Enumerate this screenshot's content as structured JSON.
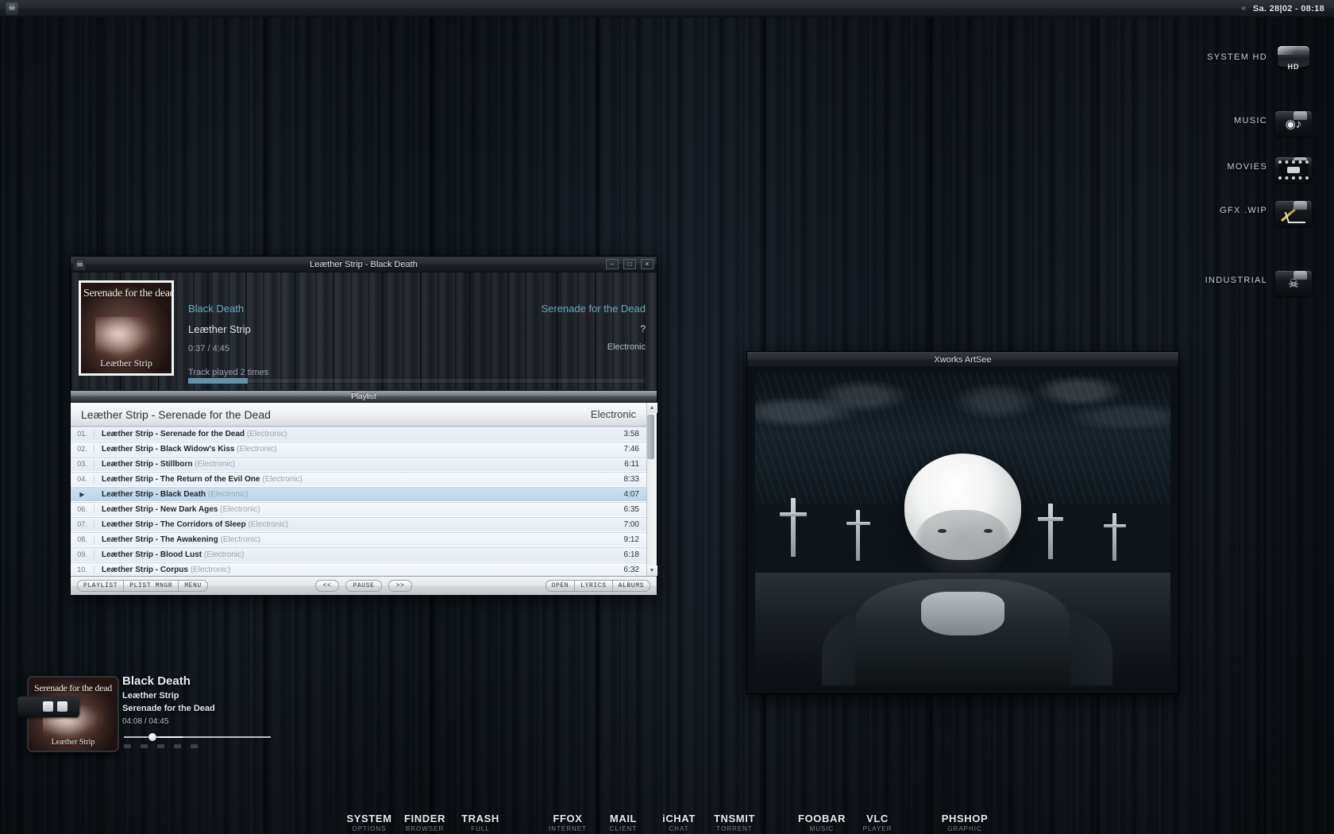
{
  "menubar": {
    "app_icon": "skull-icon",
    "collapse_arrows": "«",
    "clock": "Sa. 28|02 - 08:18"
  },
  "desktop_icons": [
    {
      "label": "SYSTEM HD",
      "icon": "harddisk-icon",
      "badge": "HD"
    },
    {
      "label": "MUSIC",
      "icon": "music-folder-icon",
      "glyph": "♫"
    },
    {
      "label": "MOVIES",
      "icon": "movies-folder-icon",
      "glyph": ""
    },
    {
      "label": "GFX .WIP",
      "icon": "graphics-folder-icon",
      "glyph": ""
    },
    {
      "label": "INDUSTRIAL",
      "icon": "skull-folder-icon",
      "glyph": "☠"
    }
  ],
  "player": {
    "window_title": "Leæther Strip - Black Death",
    "icon": "skull-icon",
    "window_buttons": {
      "minimize": "–",
      "maximize": "□",
      "close": "×"
    },
    "now_playing": {
      "track": "Black Death",
      "artist": "Leæther Strip",
      "time": "0:37 / 4:45",
      "play_count": "Track played 2 times",
      "album": "Serenade for the Dead",
      "rating": "?",
      "genre": "Electronic",
      "progress_percent": 13
    },
    "cover": {
      "title_top": "Serenade for the dead",
      "title_bottom": "Leæther Strip"
    },
    "playlist_tab": "Playlist",
    "playlist_header": {
      "title": "Leæther Strip - Serenade for the Dead",
      "genre": "Electronic"
    },
    "tracks": [
      {
        "num": "01.",
        "title": "Leæther Strip - Serenade for the Dead",
        "genre": "(Electronic)",
        "duration": "3:58",
        "playing": false
      },
      {
        "num": "02.",
        "title": "Leæther Strip - Black Widow's Kiss",
        "genre": "(Electronic)",
        "duration": "7:46",
        "playing": false
      },
      {
        "num": "03.",
        "title": "Leæther Strip - Stillborn",
        "genre": "(Electronic)",
        "duration": "6:11",
        "playing": false
      },
      {
        "num": "04.",
        "title": "Leæther Strip - The Return of the Evil One",
        "genre": "(Electronic)",
        "duration": "8:33",
        "playing": false
      },
      {
        "num": "▶",
        "title": "Leæther Strip - Black Death",
        "genre": "(Electronic)",
        "duration": "4:07",
        "playing": true
      },
      {
        "num": "06.",
        "title": "Leæther Strip - New Dark Ages",
        "genre": "(Electronic)",
        "duration": "6:35",
        "playing": false
      },
      {
        "num": "07.",
        "title": "Leæther Strip - The Corridors of Sleep",
        "genre": "(Electronic)",
        "duration": "7:00",
        "playing": false
      },
      {
        "num": "08.",
        "title": "Leæther Strip - The Awakening",
        "genre": "(Electronic)",
        "duration": "9:12",
        "playing": false
      },
      {
        "num": "09.",
        "title": "Leæther Strip - Blood Lust",
        "genre": "(Electronic)",
        "duration": "6:18",
        "playing": false
      },
      {
        "num": "10.",
        "title": "Leæther Strip - Corpus",
        "genre": "(Electronic)",
        "duration": "6:32",
        "playing": false
      }
    ],
    "toolbar": {
      "left": [
        "PLAYLIST",
        "PLIST MNGR",
        "MENU"
      ],
      "center": [
        "<<",
        "PAUSE",
        ">>"
      ],
      "right": [
        "OPEN",
        "LYRICS",
        "ALBUMS"
      ]
    },
    "scrollbar": {
      "up": "▲",
      "down": "▼"
    }
  },
  "artsee": {
    "window_title": "Xworks ArtSee"
  },
  "now_playing_widget": {
    "title": "Black Death",
    "artist": "Leæther Strip",
    "album": "Serenade for the Dead",
    "time": "04:08 / 04:45",
    "cover_top": "Serenade for the dead",
    "cover_bottom": "Leæther Strip",
    "progress_percent": 17
  },
  "dock": {
    "group_a": [
      {
        "main": "SYSTEM",
        "sub": "OPTIONS"
      },
      {
        "main": "FINDER",
        "sub": "BROWSER"
      },
      {
        "main": "TRASH",
        "sub": "FULL"
      }
    ],
    "group_b": [
      {
        "main": "FFOX",
        "sub": "INTERNET"
      },
      {
        "main": "MAIL",
        "sub": "CLIENT"
      },
      {
        "main": "iCHAT",
        "sub": "CHAT"
      },
      {
        "main": "TNSMIT",
        "sub": "TORRENT"
      }
    ],
    "group_c": [
      {
        "main": "FOOBAR",
        "sub": "MUSIC"
      },
      {
        "main": "VLC",
        "sub": "PLAYER"
      }
    ],
    "group_d": [
      {
        "main": "PHSHOP",
        "sub": "GRAPHIC"
      }
    ]
  },
  "colors": {
    "accent": "#6aa7c0",
    "seek_fill": "#5e93ab",
    "window_bg": "#1b1f24"
  }
}
